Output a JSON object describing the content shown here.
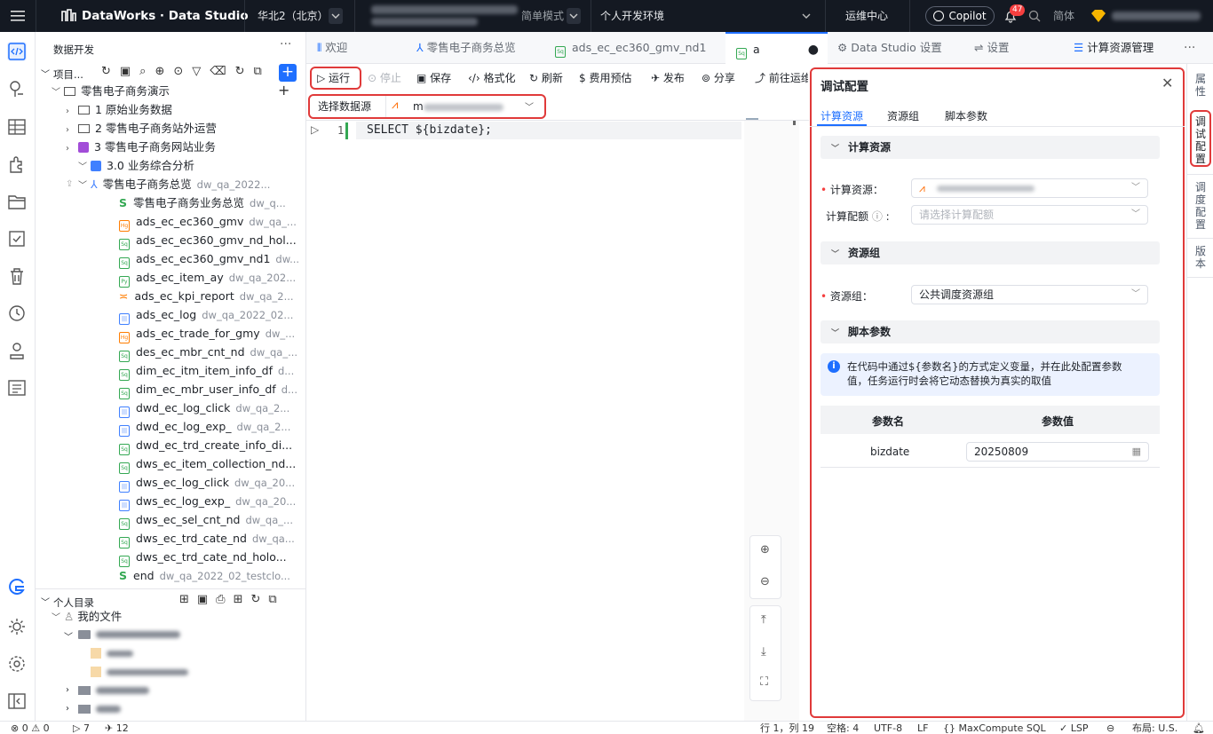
{
  "topbar": {
    "product": "DataWorks · Data Studio",
    "region": "华北2（北京）",
    "mode": "简单模式",
    "env": "个人开发环境",
    "ops": "运维中心",
    "copilot": "Copilot",
    "notifications": "47",
    "lang": "简体"
  },
  "explorer": {
    "title": "数据开发",
    "project_label": "项目...",
    "tree": [
      {
        "label": "零售电子商务演示",
        "meta": ""
      },
      {
        "label": "1 原始业务数据",
        "meta": ""
      },
      {
        "label": "2 零售电子商务站外运营",
        "meta": ""
      },
      {
        "label": "3 零售电子商务网站业务",
        "meta": ""
      },
      {
        "label": "3.0 业务综合分析",
        "meta": ""
      },
      {
        "label": "零售电子商务总览",
        "meta": "dw_qa_2022..."
      },
      {
        "label": "零售电子商务业务总览",
        "meta": "dw_q..."
      },
      {
        "label": "ads_ec_ec360_gmv",
        "meta": "dw_qa_..."
      },
      {
        "label": "ads_ec_ec360_gmv_nd_hol...",
        "meta": ""
      },
      {
        "label": "ads_ec_ec360_gmv_nd1",
        "meta": "dw..."
      },
      {
        "label": "ads_ec_item_ay",
        "meta": "dw_qa_202..."
      },
      {
        "label": "ads_ec_kpi_report",
        "meta": "dw_qa_2..."
      },
      {
        "label": "ads_ec_log",
        "meta": "dw_qa_2022_02..."
      },
      {
        "label": "ads_ec_trade_for_gmy",
        "meta": "dw_..."
      },
      {
        "label": "des_ec_mbr_cnt_nd",
        "meta": "dw_qa_..."
      },
      {
        "label": "dim_ec_itm_item_info_df",
        "meta": "d..."
      },
      {
        "label": "dim_ec_mbr_user_info_df",
        "meta": "d..."
      },
      {
        "label": "dwd_ec_log_click",
        "meta": "dw_qa_2..."
      },
      {
        "label": "dwd_ec_log_exp_",
        "meta": "dw_qa_2..."
      },
      {
        "label": "dwd_ec_trd_create_info_di...",
        "meta": ""
      },
      {
        "label": "dws_ec_item_collection_nd...",
        "meta": ""
      },
      {
        "label": "dws_ec_log_click",
        "meta": "dw_qa_20..."
      },
      {
        "label": "dws_ec_log_exp_",
        "meta": "dw_qa_20..."
      },
      {
        "label": "dws_ec_sel_cnt_nd",
        "meta": "dw_qa_..."
      },
      {
        "label": "dws_ec_trd_cate_nd",
        "meta": "dw_qa..."
      },
      {
        "label": "dws_ec_trd_cate_nd_holo...",
        "meta": ""
      },
      {
        "label": "end",
        "meta": "dw_qa_2022_02_testclo..."
      }
    ],
    "personal_title": "个人目录",
    "my_files": "我的文件"
  },
  "tabs": [
    {
      "label": "欢迎"
    },
    {
      "label": "零售电子商务总览"
    },
    {
      "label": "ads_ec_ec360_gmv_nd1"
    },
    {
      "label": "a"
    },
    {
      "label": "Data Studio 设置"
    },
    {
      "label": "设置"
    },
    {
      "label": "计算资源管理"
    }
  ],
  "toolbar": {
    "run": "运行",
    "stop": "停止",
    "save": "保存",
    "format": "格式化",
    "refresh": "刷新",
    "cost": "费用预估",
    "publish": "发布",
    "share": "分享",
    "goto": "前往运维"
  },
  "datasource": {
    "label": "选择数据源",
    "value": "m"
  },
  "editor": {
    "line_number": "1",
    "code": "SELECT ${bizdate};"
  },
  "panel": {
    "title": "调试配置",
    "tabs": [
      "计算资源",
      "资源组",
      "脚本参数"
    ],
    "compute_section": "计算资源",
    "compute_label": "计算资源：",
    "quota_label": "计算配额",
    "quota_placeholder": "请选择计算配额",
    "rg_section": "资源组",
    "rg_label": "资源组：",
    "rg_value": "公共调度资源组",
    "param_section": "脚本参数",
    "info": "在代码中通过${参数名}的方式定义变量，并在此处配置参数值，任务运行时会将它动态替换为真实的取值",
    "col_name": "参数名",
    "col_value": "参数值",
    "param_name": "bizdate",
    "param_value": "20250809"
  },
  "rail": [
    "属性",
    "调试配置",
    "调度配置",
    "版本"
  ],
  "status": {
    "errors": "0",
    "warnings": "0",
    "forward": "7",
    "send": "12",
    "position": "行 1，列 19",
    "spaces": "空格: 4",
    "encoding": "UTF-8",
    "eol": "LF",
    "language": "MaxCompute SQL",
    "lsp": "LSP",
    "layout": "布局: U.S."
  }
}
